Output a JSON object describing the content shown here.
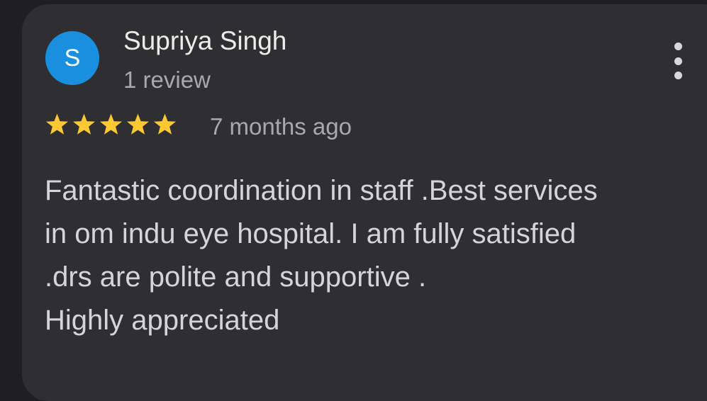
{
  "review": {
    "author": {
      "initial": "S",
      "name": "Supriya Singh",
      "review_count": "1 review",
      "avatar_color": "#1a8fe0"
    },
    "menu": {
      "icon": "more-vert-icon"
    },
    "rating": {
      "value": 5,
      "max": 5,
      "star_color": "#fcc934"
    },
    "time": "7 months ago",
    "text_lines": [
      "Fantastic coordination in staff .Best services",
      "in om indu eye hospital. I am fully satisfied",
      ".drs are polite and supportive .",
      "Highly appreciated"
    ]
  }
}
